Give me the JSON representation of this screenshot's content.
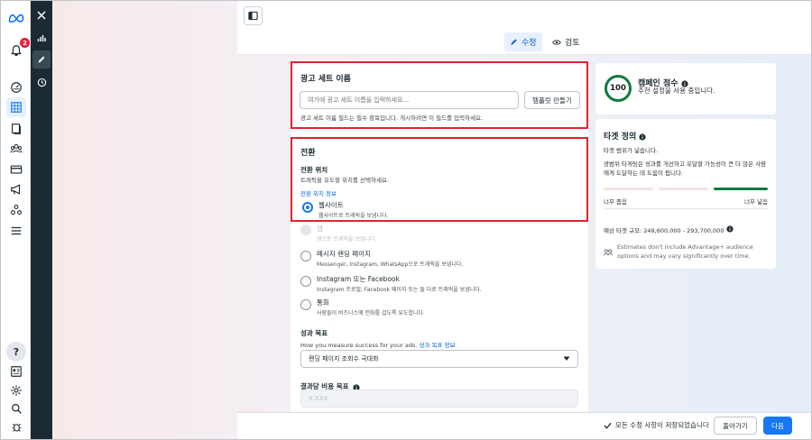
{
  "nav": {
    "notification_count": "2"
  },
  "tabs": {
    "edit": "수정",
    "review": "검토"
  },
  "adset_name": {
    "heading": "광고 세트 이름",
    "placeholder": "여기에 광고 세트 이름을 입력하세요...",
    "template_button": "템플릿 만들기",
    "helper": "광고 세트 이름 필드는 필수 항목입니다. 게시하려면 이 필드를 입력하세요."
  },
  "conversion": {
    "heading": "전환",
    "location_label": "전환 위치",
    "location_desc": "트래픽을 유도할 위치를 선택하세요.",
    "info_link": "전환 위치 정보",
    "options": [
      {
        "title": "웹사이트",
        "desc": "웹사이트로 트래픽을 보냅니다."
      },
      {
        "title": "앱",
        "desc": "앱으로 트래픽을 보냅니다."
      },
      {
        "title": "메시지 랜딩 페이지",
        "desc": "Messenger, Instagram, WhatsApp으로 트래픽을 보냅니다."
      },
      {
        "title": "Instagram 또는 Facebook",
        "desc": "Instagram 프로필, Facebook 페이지 또는 둘 다로 트래픽을 보냅니다."
      },
      {
        "title": "통화",
        "desc": "사람들이 비즈니스에 전화를 걸도록 유도합니다."
      }
    ]
  },
  "performance": {
    "label": "성과 목표",
    "desc": "How you measure success for your ads.",
    "link": "성과 목표 정보",
    "selected": "랜딩 페이지 조회수 극대화"
  },
  "cost_goal": {
    "label": "결과당 비용 목표",
    "placeholder": "X.XXX"
  },
  "campaign_score": {
    "value": "100",
    "title": "캠페인 점수",
    "desc": "추천 설정을 사용 중입니다."
  },
  "audience": {
    "title": "타겟 정의",
    "status": "타겟 범위가 넓습니다.",
    "desc": "광범위 타게팅은 성과를 개선하고 유달할 가능성이 큰 더 많은 사람에게 도달하는 데 도움이 됩니다.",
    "narrow_label": "너무 좁음",
    "broad_label": "너무 넓음",
    "reach": "예상 타겟 규모: 249,600,000 - 293,700,000",
    "note_line1": "Estimates don't include Advantage+ audience",
    "note_line2": "options and may vary significantly over time."
  },
  "footer": {
    "saved": "모든 수정 사항이 저장되었습니다",
    "back": "돌아가기",
    "next": "다음"
  },
  "colors": {
    "accent": "#1877f2",
    "highlight": "#e0242e",
    "dark_rail": "#1c2b33",
    "score_ring": "#0f7b3d"
  }
}
